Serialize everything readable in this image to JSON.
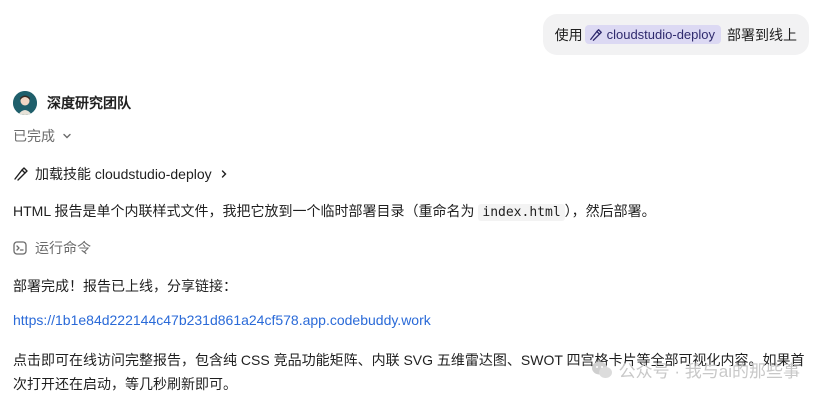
{
  "user_message": {
    "prefix": "使用",
    "skill_chip": "cloudstudio-deploy",
    "suffix": "部署到线上"
  },
  "agent": {
    "name": "深度研究团队",
    "status": "已完成"
  },
  "skill_load": {
    "label": "加载技能 cloudstudio-deploy"
  },
  "message1": {
    "part1": "HTML 报告是单个内联样式文件，我把它放到一个临时部署目录（重命名为 ",
    "code": "index.html",
    "part2": "），然后部署。"
  },
  "run_command": {
    "label": "运行命令"
  },
  "message2": "部署完成！报告已上线，分享链接：",
  "deploy_link": "https://1b1e84d222144c47b231d861a24cf578.app.codebuddy.work",
  "message3": {
    "line1": "点击即可在线访问完整报告，包含纯 CSS 竞品功能矩阵、内联 SVG 五维雷达图、SWOT 四宫格卡片等全部可视化内容。如果首",
    "line2": "次打开还在启动，等几秒刷新即可。"
  },
  "watermark": "公众号 · 我与ai的那些事"
}
